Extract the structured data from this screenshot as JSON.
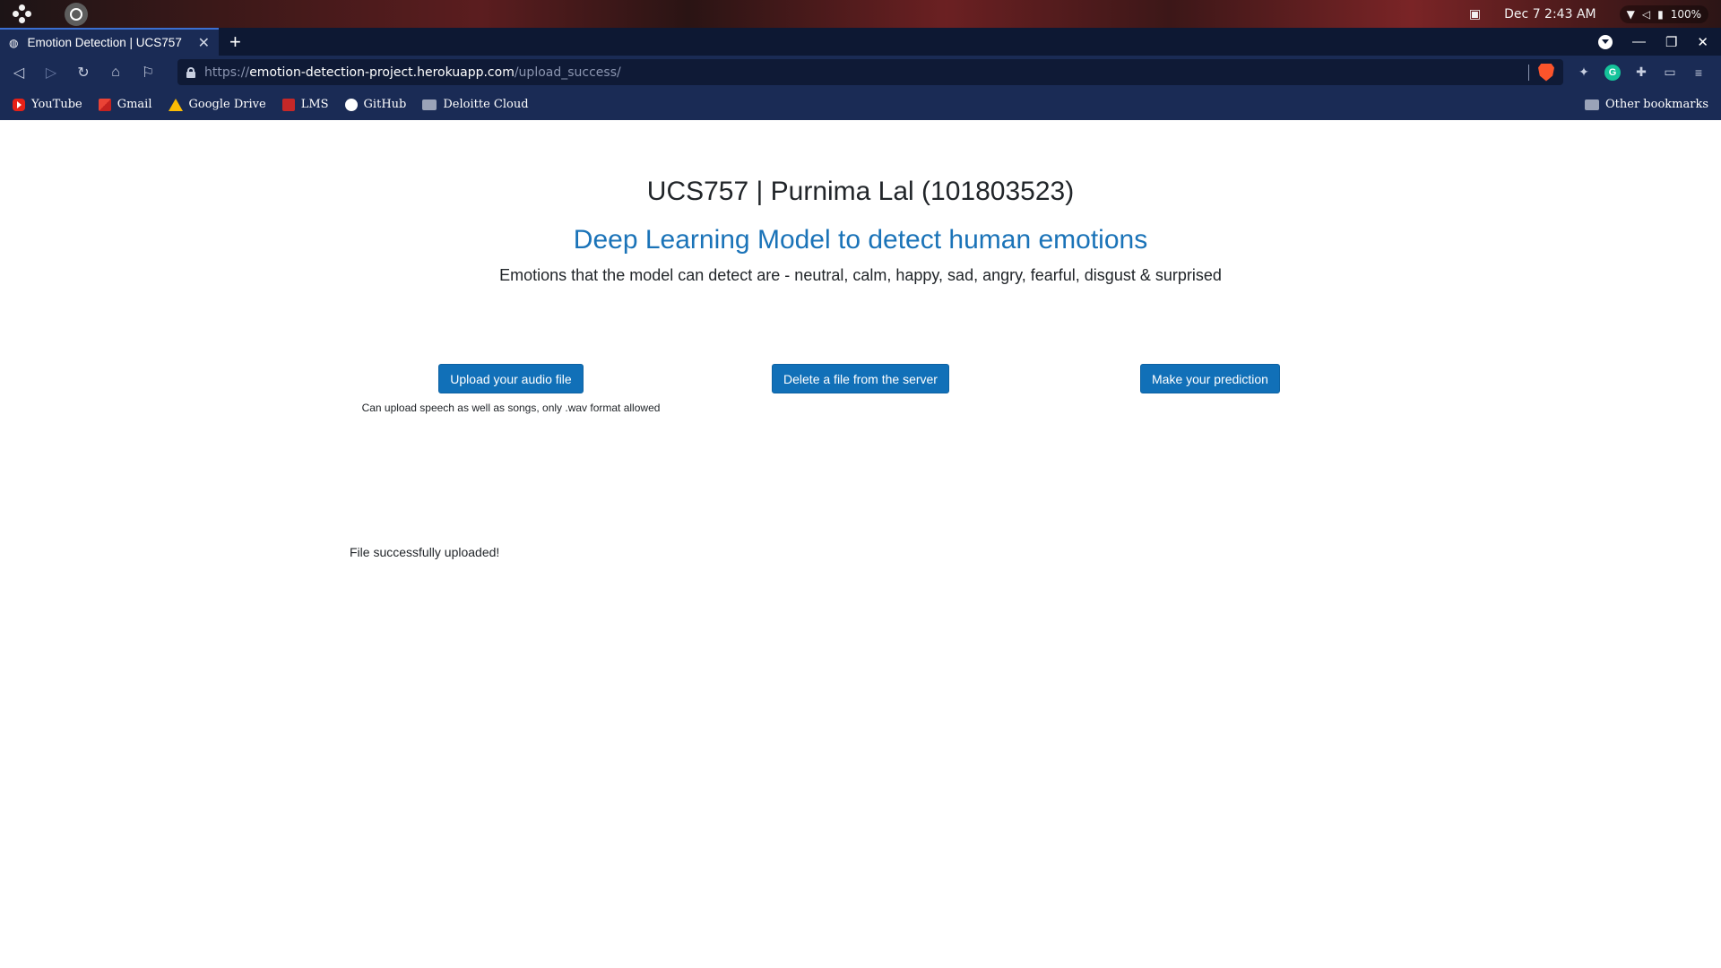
{
  "os_bar": {
    "clock": "Dec 7  2:43 AM",
    "battery": "100%"
  },
  "tab": {
    "title": "Emotion Detection | UCS757",
    "close_symbol": "✕",
    "new_tab_symbol": "+"
  },
  "toolbar": {
    "url_scheme": "https://",
    "url_host": "emotion-detection-project.herokuapp.com",
    "url_path": "/upload_success/"
  },
  "bookmarks": {
    "items": [
      {
        "label": "YouTube",
        "icon": "youtube-icon"
      },
      {
        "label": "Gmail",
        "icon": "gmail-icon"
      },
      {
        "label": "Google Drive",
        "icon": "google-drive-icon"
      },
      {
        "label": "LMS",
        "icon": "lms-icon"
      },
      {
        "label": "GitHub",
        "icon": "github-icon"
      },
      {
        "label": "Deloitte Cloud",
        "icon": "folder-icon"
      }
    ],
    "other": "Other bookmarks"
  },
  "page": {
    "title": "UCS757 | Purnima Lal (101803523)",
    "heading": "Deep Learning Model to detect human emotions",
    "subtitle": "Emotions that the model can detect are - neutral, calm, happy, sad, angry, fearful, disgust & surprised",
    "upload_button": "Upload your audio file",
    "upload_hint": "Can upload speech as well as songs, only .wav format allowed",
    "delete_button": "Delete a file from the server",
    "predict_button": "Make your prediction",
    "status_message": "File successfully uploaded!"
  },
  "colors": {
    "accent": "#1170b8",
    "heading": "#1a73b8",
    "browser_frame": "#1a2b55"
  }
}
